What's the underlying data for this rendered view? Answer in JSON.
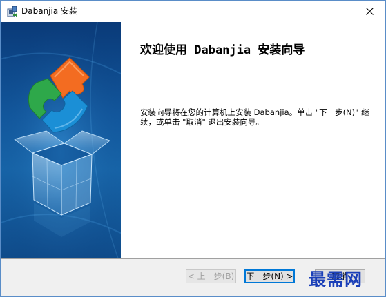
{
  "window": {
    "title": "Dabanjia 安装"
  },
  "content": {
    "heading": "欢迎使用 Dabanjia 安装向导",
    "description": "安装向导将在您的计算机上安装 Dabanjia。单击 \"下一步(N)\" 继续，或单击 \"取消\" 退出安装向导。"
  },
  "buttons": {
    "back": "< 上一步(B)",
    "next": "下一步(N) >",
    "cancel": "取消"
  },
  "watermark": "最需网",
  "colors": {
    "accent": "#0078d7",
    "banner_dark": "#0a3a78",
    "banner_light": "#1766aa",
    "puzzle_orange": "#f36c21",
    "puzzle_green": "#2ea84a",
    "puzzle_blue": "#1b8fd6",
    "watermark": "#1a3fb8"
  }
}
